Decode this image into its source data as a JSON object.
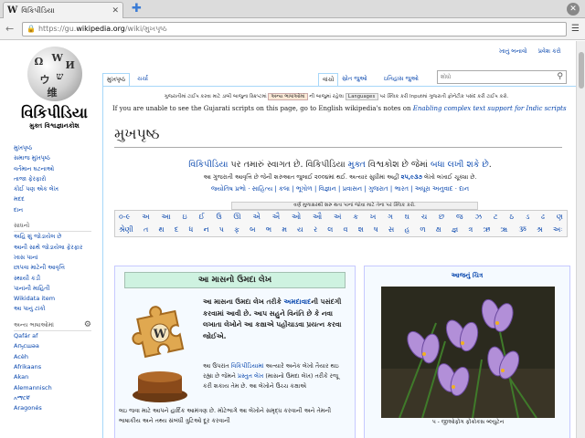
{
  "browser": {
    "tab_title": "વિકિપીડિયા",
    "url_prefix": "https://gu.",
    "url_domain": "wikipedia.org",
    "url_path": "/wiki/મુખપૃષ્ઠ"
  },
  "personal": {
    "create": "ખાતું બનાવો",
    "login": "પ્રવેશ કરો"
  },
  "logo": {
    "title": "વિકિપીડિયા",
    "subtitle": "મુક્ત વિશ્વજ્ઞાનકોશ"
  },
  "sidebar": {
    "main": [
      "મુખપૃષ્ઠ",
      "સમાજ મુખપૃષ્ઠ",
      "વર્તમાન ઘટનાઓ",
      "તાજા ફેરફારો",
      "કોઈ પણ એક લેખ",
      "મદદ",
      "દાન"
    ],
    "tools_head": "સાધનો",
    "tools": [
      "અહિ શું જોડાયેલ છે",
      "આની સાથે જોડાયેલા ફેરફાર",
      "ખાસ પાનાં",
      "છાપવા માટેની આવૃત્તિ",
      "સ્થાયી કડી",
      "પાનાંની માહિતી",
      "Wikidata item",
      "આ પાનું ટાંકો"
    ],
    "lang_head": "અન્ય ભાષાઓમાં",
    "langs": [
      "Qafár af",
      "Аҧсшәа",
      "Acèh",
      "Afrikaans",
      "Akan",
      "Alemannisch",
      "አማርኛ",
      "Aragonés"
    ]
  },
  "tabs": {
    "main": "મુખપૃષ્ઠ",
    "talk": "ચર્ચા",
    "read": "વાંચો",
    "source": "સ્રોત જુઓ",
    "history": "ઇતિહાસ જુઓ"
  },
  "search": {
    "placeholder": "શોધો"
  },
  "notice": {
    "gu_text": "ગુજરાતીમાં ટાઈપ કરવા માટે ડાબી બાજુના સ્ક્રિપ્ટમાં",
    "kbd1": "અન્ય ભાષાઓમાં",
    "mid": "ની બાજુમાં રહેલા",
    "kbd2": "Languages",
    "end": "પર ક્લિક કરી Inputમાં ગુજરાતી ફોનેટીક પસંદ કરી ટાઈપ કરો.",
    "en_text": "If you are unable to see the Gujarati scripts on this page, go to English wikipedia's notes on",
    "en_link": "Enabling complex text support for Indic scripts"
  },
  "title": "મુખપૃષ્ઠ",
  "welcome": {
    "line1_a": "વિકિપીડિયા",
    "line1_b": " પર તમારું સ્વાગત છે. વિકિપીડિયા ",
    "line1_c": "મુક્ત",
    "line1_d": " વિશ્વકોશ છે જેમાં ",
    "line1_e": "બધા લખી શકે છે",
    "line1_f": ".",
    "line2_a": "આ ગુજરાતી આવૃત્તિ છે જેની શરુઆત જુલાઈ ૨૦૦૪માં થઈ. અત્યાર સુધીમાં અહીં ",
    "line2_b": "૨૫,૯૩૭",
    "line2_c": " લેખો લખાઈ ચૂક્યા છે.",
    "portals": "જ્યોતિષ પ્રભો · સાહિત્ય | કલા | ભૂગોળ | વિજ્ઞાન | પ્રવાસન | ગુજરાત | ભારત | અધૂરા અનુવાદ · દાન"
  },
  "alphabet": {
    "header": "વર્ણ મુળાક્ષરથી શરુ થતા પાનાં જોવા માટે તેના પર ક્લિક કરો.",
    "row1": [
      "૦-૯",
      "અ",
      "આ",
      "ઇ",
      "ઈ",
      "ઉ",
      "ઊ",
      "એ",
      "ઐ",
      "ઓ",
      "ઔ",
      "અં",
      "ક",
      "ખ",
      "ગ",
      "ઘ",
      "ચ",
      "છ",
      "જ",
      "ઝ",
      "ટ",
      "ઠ",
      "ડ",
      "ઢ",
      "ણ"
    ],
    "row2": [
      "શ્રેણી",
      "ત",
      "થ",
      "દ",
      "ધ",
      "ન",
      "પ",
      "ફ",
      "બ",
      "ભ",
      "મ",
      "ય",
      "ર",
      "લ",
      "વ",
      "શ",
      "ષ",
      "સ",
      "હ",
      "ળ",
      "ક્ષ",
      "જ્ઞ",
      "ત્ર",
      "ઋ",
      "ૠ",
      "ૐ",
      "શ્ર",
      "અઃ"
    ]
  },
  "featured": {
    "head": "આ માસનો ઉમદા લેખ",
    "bold_a": "આ માસના ઉમદા લેખ તરીકે ",
    "bold_link": "અમદાવાદ",
    "bold_b": "ની પસંદગી કરવામાં આવી છે. આપ સહુને વિનંતિ છે કે નવા લખાતા લેખોને આ કક્ષાએ પહોંચાડવા પ્રયત્ન કરવા જોઈએ.",
    "text_a": "આ ઉપરાંત ",
    "text_link1": "વિકિપીડિયામાં",
    "text_b": " અત્યારે અનેક લેખો તૈયાર થઇ રહ્યા છે જેમને ",
    "text_link2": "પ્રસ્તુત લેખ",
    "text_c": " (માસનો ઉમદા લેખ) તરીકે રજૂ કરી શકાય તેમ છે. આ લેખોને ઉચ્ચ કક્ષાએ",
    "text_d": "લઇ જવા માટે આપને હાર્દિક આમંત્રણ છે. મોટેભાગે આ લેખોને સમૃદ્ધ કરવાની અને તેમની ભાષાકીય અને તથ્ય સંબંધી ત્રુટિઓ દૂર કરવાની"
  },
  "pod": {
    "head": "આજનું ચિત્ર",
    "caption": "૫ - જીઓફોંગ ફોંક્રોકસ બ્લ્યુટેન"
  }
}
